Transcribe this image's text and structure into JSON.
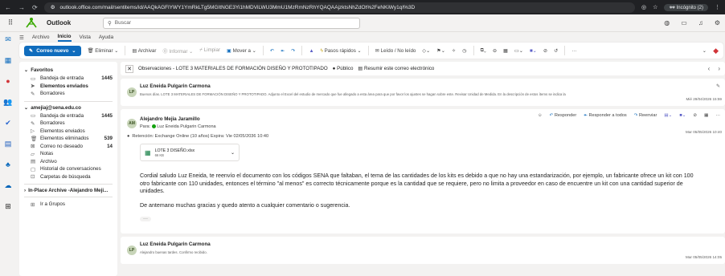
{
  "browser": {
    "url": "outlook.office.com/mail/sentitems/id/AAQkAGFlYWY1YmRkLTg5MGItNGE3Yi1hMDViLWU3MmU1MzRmNzRhYQAQAAjzktsNhZdOt%2FeNKiWy1qI%3D",
    "incognito_label": "Incógnito (2)"
  },
  "header": {
    "app_name": "Outlook",
    "search_placeholder": "Buscar"
  },
  "tabs": [
    "Archivo",
    "Inicio",
    "Vista",
    "Ayuda"
  ],
  "ribbon": {
    "new_mail": "Correo nuevo",
    "delete": "Eliminar",
    "archive": "Archivar",
    "report": "Informar",
    "clean": "Limpiar",
    "move": "Mover a",
    "quick_steps": "Pasos rápidos",
    "read_unread": "Leído / No leído"
  },
  "folders": {
    "favorites_title": "Favoritos",
    "favorites": [
      {
        "label": "Bandeja de entrada",
        "count": "1445",
        "icon": "inbox-icon"
      },
      {
        "label": "Elementos enviados",
        "count": "",
        "icon": "send-icon",
        "selected": true
      },
      {
        "label": "Borradores",
        "count": "",
        "icon": "pencil-icon"
      }
    ],
    "account_title": "amejiaj@sena.edu.co",
    "account": [
      {
        "label": "Bandeja de entrada",
        "count": "1445",
        "icon": "inbox-icon"
      },
      {
        "label": "Borradores",
        "count": "",
        "icon": "pencil-icon"
      },
      {
        "label": "Elementos enviados",
        "count": "",
        "icon": "send-icon"
      },
      {
        "label": "Elementos eliminados",
        "count": "539",
        "icon": "trash-icon"
      },
      {
        "label": "Correo no deseado",
        "count": "14",
        "icon": "junk-icon"
      },
      {
        "label": "Notas",
        "count": "",
        "icon": "note-icon"
      },
      {
        "label": "Archivo",
        "count": "",
        "icon": "archive-icon"
      },
      {
        "label": "Historial de conversaciones",
        "count": "",
        "icon": "folder-icon"
      },
      {
        "label": "Carpetas de búsqueda",
        "count": "",
        "icon": "search-folder-icon"
      }
    ],
    "inplace_archive": "In-Place Archive -Alejandro Meji...",
    "groups": "Ir a Grupos"
  },
  "reading": {
    "subject": "Observaciones - LOTE 3 MATERIALES DE FORMACIÓN DISEÑO Y PROTOTIPADO",
    "visibility": "Público",
    "summarize": "Resumir este correo electrónico",
    "messages": [
      {
        "from": "Luz Eneida Pulgarin Carmona",
        "snippet": "Buenos días. LOTE 3 MATERIALES DE FORMACIÓN DISEÑO Y PROTOTIPADO. Adjunto el Excel del estudio de mercado que fue allegado a esta área para que por favor los ajustes se hagan sobre este. Revisar Unidad de Medida. En la descripción de estos ítems se indica la",
        "date": "Mié 29/04/2026 15:59"
      },
      {
        "from": "Luz Eneida Pulgarin Carmona",
        "snippet": "Alejandro buenas tardes. Confirmo recibido.",
        "date": "Mar 05/05/2026 14:05"
      }
    ],
    "open_message": {
      "from": "Alejandro Mejia Jaramillo",
      "to_label": "Para:",
      "to": "Luz Eneida Pulgarin Carmona",
      "date": "Mar 05/05/2026 10:40",
      "reply": "Responder",
      "reply_all": "Responder a todos",
      "forward": "Reenviar",
      "retention": "Retención: Exchange Online (10 años) Expira: Vie 02/05/2036 10:40",
      "attachment_name": "LOTE 3 DISEÑO.xlsx",
      "attachment_size": "66 KB",
      "body_1": "Cordial saludo Luz Eneida, te reenvío el documento con los códigos SENA que faltaban, el tema de las cantidades de los kits es debido a que no hay una estandarización, por ejemplo, un fabricante ofrece un kit con 100 otro fabricante con 110 unidades, entonces el término \"al menos\" es correcto técnicamente porque es la cantidad que se requiere, pero no limita a proveedor en caso de encuentre un kit con una cantidad superior de unidades.",
      "body_2": "De antemano muchas gracias y quedo atento a cualquier comentario o sugerencia.",
      "ellipsis": "···"
    }
  },
  "colors": {
    "accent": "#0f6cbd",
    "background": "#f3f2f1",
    "presence": "#13a10e"
  }
}
